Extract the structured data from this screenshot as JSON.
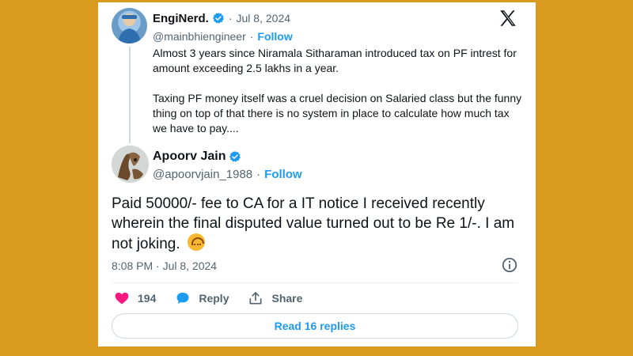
{
  "colors": {
    "background": "#d99a1e",
    "card": "#ffffff",
    "accent_blue": "#1d9bf0",
    "like_pink": "#f91880",
    "text": "#0f1419",
    "muted": "#536471"
  },
  "parent_tweet": {
    "name": "EngiNerd.",
    "verified_icon": "verified-badge-icon",
    "date": "Jul 8, 2024",
    "handle": "@mainbhiengineer",
    "follow_label": "Follow",
    "paragraphs": [
      "Almost 3 years since Niramala Sitharaman introduced tax on PF intrest for amount exceeding 2.5 lakhs in a year.",
      "Taxing PF money itself was a cruel decision on Salaried class but the funny thing on top of that there is no system in place to calculate how much tax we have to pay...."
    ]
  },
  "main_tweet": {
    "name": "Apoorv Jain",
    "verified_icon": "verified-badge-icon",
    "handle": "@apoorvjain_1988",
    "follow_label": "Follow",
    "text": "Paid 50000/- fee to CA for a IT notice I received recently wherein the final disputed value turned out to be Re 1/-. I am not joking.",
    "emoji": "upside-down-face-emoji",
    "timestamp": "8:08 PM · Jul 8, 2024",
    "likes": "194",
    "reply_label": "Reply",
    "share_label": "Share",
    "read_replies_label": "Read 16 replies"
  },
  "separator_dot": "·",
  "icons": [
    "x-logo-icon",
    "info-icon",
    "heart-icon",
    "reply-icon",
    "share-icon"
  ]
}
